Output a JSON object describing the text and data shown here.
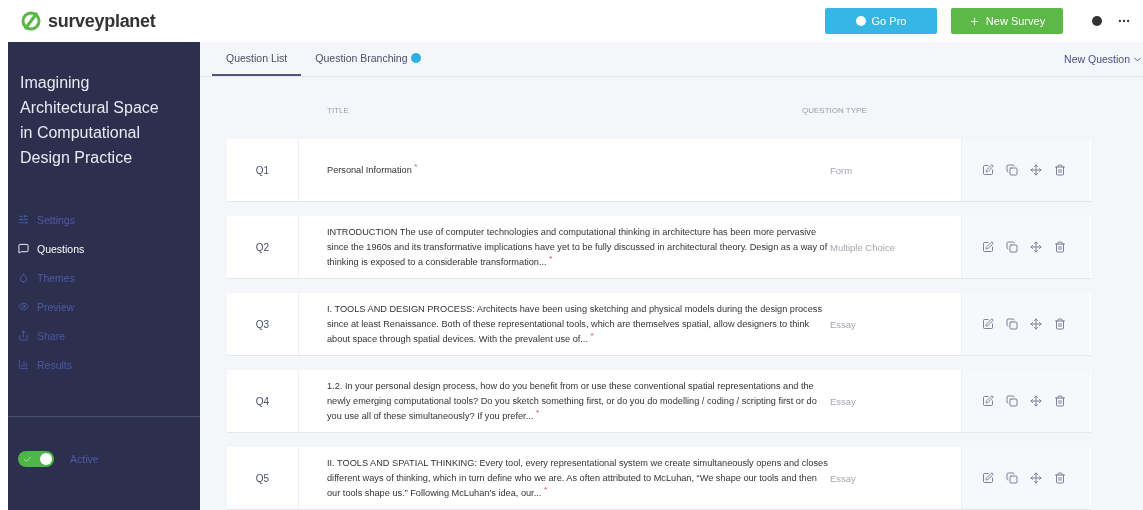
{
  "header": {
    "logo": "surveyplanet",
    "go_pro": "Go Pro",
    "new_survey": "New Survey"
  },
  "sidebar": {
    "survey_title": "Imagining Architectural Space in Computational Design Practice",
    "items": [
      {
        "label": "Settings",
        "kind": "settings",
        "selected": false
      },
      {
        "label": "Questions",
        "kind": "questions",
        "selected": true
      },
      {
        "label": "Themes",
        "kind": "themes",
        "selected": false
      },
      {
        "label": "Preview",
        "kind": "preview",
        "selected": false
      },
      {
        "label": "Share",
        "kind": "share",
        "selected": false
      },
      {
        "label": "Results",
        "kind": "results",
        "selected": false
      }
    ],
    "active_toggle": {
      "label": "Active",
      "on": true
    }
  },
  "tabs": [
    {
      "label": "Question List",
      "selected": true,
      "badge": false
    },
    {
      "label": "Question Branching",
      "selected": false,
      "badge": true
    }
  ],
  "new_question": "New Question",
  "table": {
    "columns": [
      "TITLE",
      "QUESTION TYPE"
    ],
    "rows": [
      {
        "number": "Q1",
        "title": "Personal Information $^{*}$",
        "type": "Form"
      },
      {
        "number": "Q2",
        "title": "INTRODUCTION The use of computer technologies and computational thinking in architecture has been more pervasive since the 1960s and its transformative implications have yet to be fully discussed in architectural theory. Design as a way of thinking is exposed to a considerable transformation... $^{*}$",
        "type": "Multiple Choice"
      },
      {
        "number": "Q3",
        "title": "I. TOOLS AND DESIGN PROCESS: Architects have been using sketching and physical models during the design process since at least Renaissance. Both of these representational tools, which are themselves spatial, allow designers to think about space through spatial devices. With the prevalent use of... $^{*}$",
        "type": "Essay"
      },
      {
        "number": "Q4",
        "title": "1.2. In your personal design process, how do you benefit from or use these conventional spatial representations and the newly emerging computational tools? Do you sketch something first, or do you do modelling / coding / scripting first or do you use all of these simultaneously? If you prefer... $^{*}$",
        "type": "Essay"
      },
      {
        "number": "Q5",
        "title": "II. TOOLS AND SPATIAL THINKING: Every tool, every representational system we create simultaneously opens and closes different ways of thinking, which in turn define who we are. As often attributed to McLuhan, “We shape our tools and then our tools shape us.” Following McLuhan’s idea, our... $^{*}$",
        "type": "Essay"
      }
    ]
  }
}
